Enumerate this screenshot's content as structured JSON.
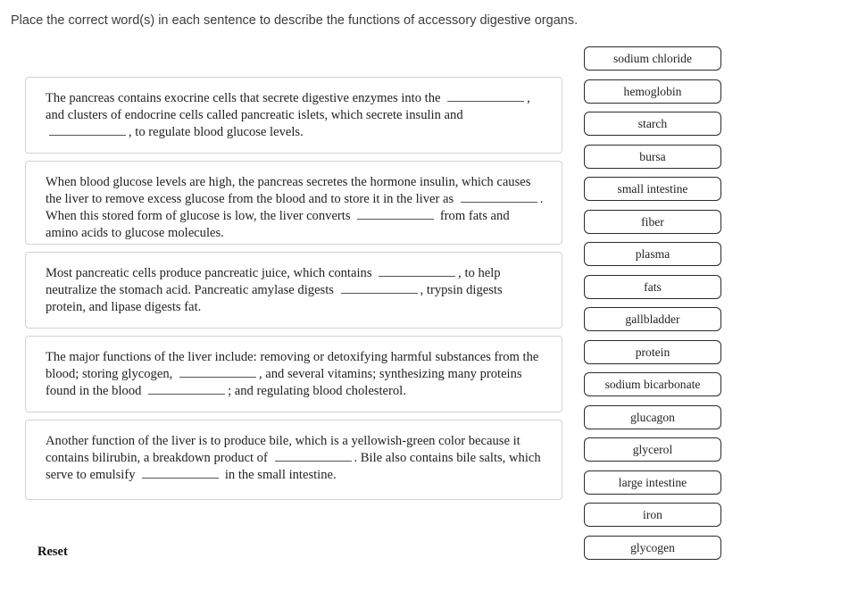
{
  "instruction": "Place the correct word(s) in each sentence to describe the functions of accessory digestive organs.",
  "questions": [
    {
      "id": "q1",
      "segments": [
        {
          "type": "text",
          "value": "The pancreas contains exocrine cells that secrete digestive enzymes into the "
        },
        {
          "type": "blank"
        },
        {
          "type": "text",
          "value": ", and clusters of endocrine cells called pancreatic islets, which secrete insulin and "
        },
        {
          "type": "blank"
        },
        {
          "type": "text",
          "value": ", to regulate blood glucose levels."
        }
      ]
    },
    {
      "id": "q2",
      "segments": [
        {
          "type": "text",
          "value": "When blood glucose levels are high, the pancreas secretes the hormone insulin, which causes the liver to remove excess glucose from the blood and to store it in the liver as "
        },
        {
          "type": "blank"
        },
        {
          "type": "text",
          "value": ". When this stored form of glucose is low, the liver converts "
        },
        {
          "type": "blank"
        },
        {
          "type": "text",
          "value": " from fats and amino acids to glucose molecules."
        }
      ]
    },
    {
      "id": "q3",
      "segments": [
        {
          "type": "text",
          "value": "Most pancreatic cells produce pancreatic juice, which contains "
        },
        {
          "type": "blank"
        },
        {
          "type": "text",
          "value": ", to help neutralize the stomach acid. Pancreatic amylase digests "
        },
        {
          "type": "blank"
        },
        {
          "type": "text",
          "value": ", trypsin digests protein, and lipase digests fat."
        }
      ]
    },
    {
      "id": "q4",
      "segments": [
        {
          "type": "text",
          "value": "The major functions of the liver include: removing or detoxifying harmful substances from the blood; storing glycogen, "
        },
        {
          "type": "blank"
        },
        {
          "type": "text",
          "value": ", and several vitamins; synthesizing many proteins found in the blood "
        },
        {
          "type": "blank"
        },
        {
          "type": "text",
          "value": "; and regulating blood cholesterol."
        }
      ]
    },
    {
      "id": "q5",
      "segments": [
        {
          "type": "text",
          "value": "Another function of the liver is to produce bile, which is a yellowish-green color because it contains bilirubin, a breakdown product of "
        },
        {
          "type": "blank"
        },
        {
          "type": "text",
          "value": ". Bile also contains bile salts, which serve to emulsify "
        },
        {
          "type": "blank"
        },
        {
          "type": "text",
          "value": " in the small intestine."
        }
      ]
    }
  ],
  "word_bank": [
    "sodium chloride",
    "hemoglobin",
    "starch",
    "bursa",
    "small intestine",
    "fiber",
    "plasma",
    "fats",
    "gallbladder",
    "protein",
    "sodium bicarbonate",
    "glucagon",
    "glycerol",
    "large intestine",
    "iron",
    "glycogen"
  ],
  "reset_label": "Reset",
  "colors": {
    "page_background": "#ffffff",
    "box_border": "#d2d2d2",
    "chip_border": "#2b2b2b",
    "heading_text": "#3c3c3c",
    "body_text": "#222222"
  }
}
